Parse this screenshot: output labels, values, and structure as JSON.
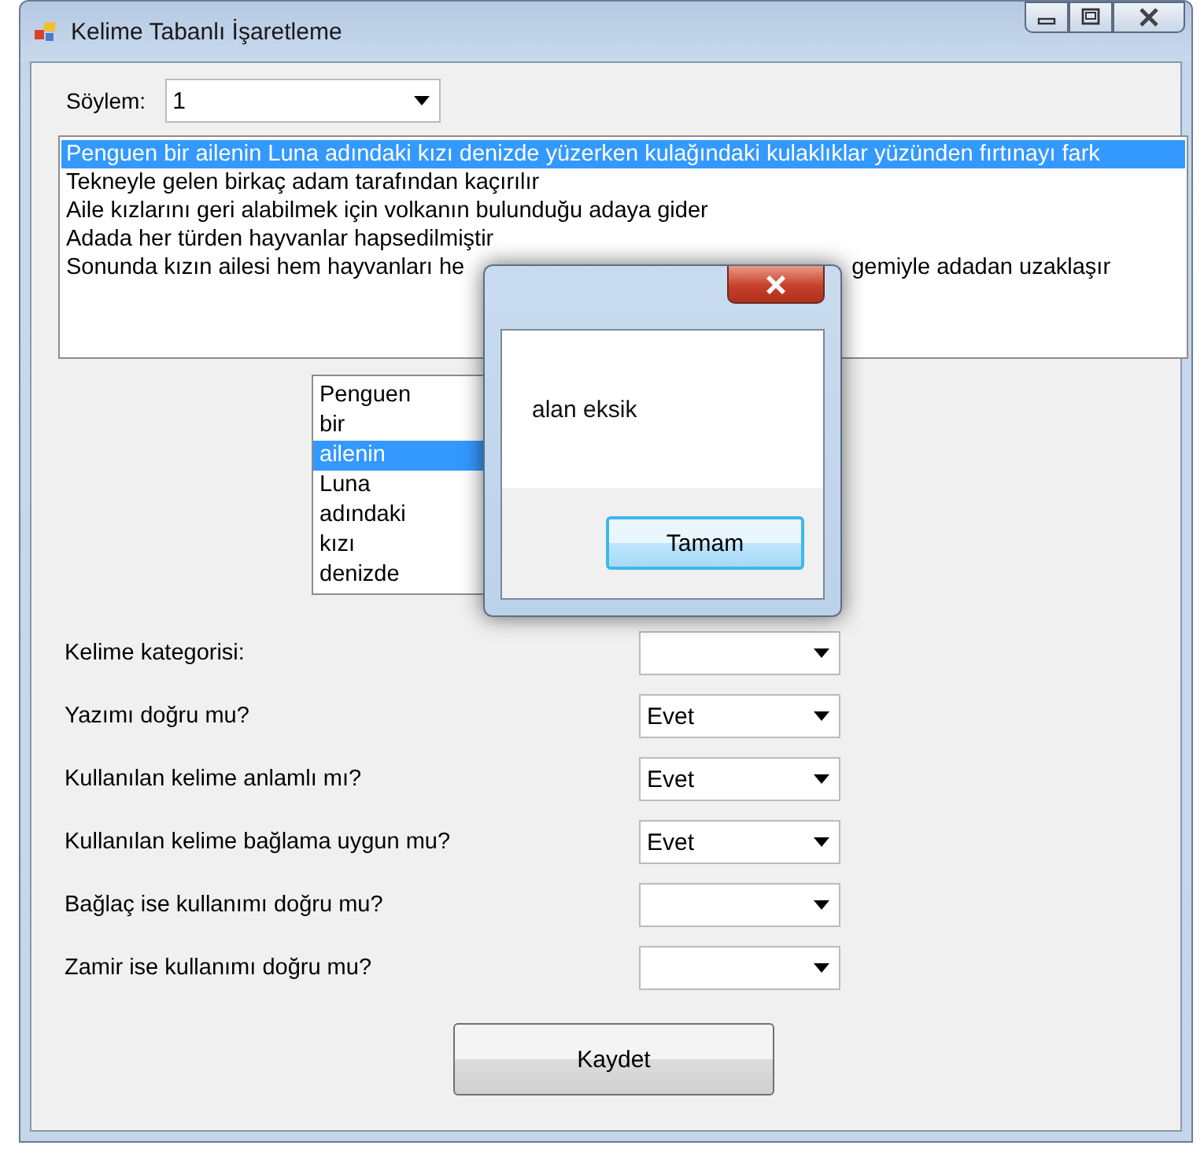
{
  "window": {
    "title": "Kelime Tabanlı İşaretleme"
  },
  "sentence_field": {
    "label": "Söylem:",
    "value": "1"
  },
  "sentences": [
    {
      "text": "Penguen bir ailenin Luna adındaki kızı denizde yüzerken kulağındaki kulaklıklar yüzünden fırtınayı fark",
      "selected": true
    },
    {
      "text": "Tekneyle gelen birkaç adam tarafından kaçırılır",
      "selected": false
    },
    {
      "text": "Aile kızlarını geri alabilmek için volkanın bulunduğu adaya gider",
      "selected": false
    },
    {
      "text": "Adada her türden hayvanlar hapsedilmiştir",
      "selected": false
    },
    {
      "text": "Sonunda kızın ailesi hem hayvanları he",
      "text_after": "gemiyle adadan uzaklaşır",
      "selected": false
    }
  ],
  "words": [
    {
      "text": "Penguen",
      "selected": false
    },
    {
      "text": "bir",
      "selected": false
    },
    {
      "text": "ailenin",
      "selected": true
    },
    {
      "text": "Luna",
      "selected": false
    },
    {
      "text": "adındaki",
      "selected": false
    },
    {
      "text": "kızı",
      "selected": false
    },
    {
      "text": "denizde",
      "selected": false
    }
  ],
  "questions": [
    {
      "label": "Kelime kategorisi:"
    },
    {
      "label": "Yazımı doğru mu?",
      "value": "Evet"
    },
    {
      "label": "Kullanılan kelime anlamlı mı?",
      "value": "Evet"
    },
    {
      "label": "Kullanılan kelime bağlama uygun mu?",
      "value": "Evet"
    },
    {
      "label": "Bağlaç ise kullanımı doğru mu?"
    },
    {
      "label": "Zamir ise kullanımı doğru mu?"
    }
  ],
  "save_button": "Kaydet",
  "dialog": {
    "message": "alan eksik",
    "button": "Tamam"
  }
}
